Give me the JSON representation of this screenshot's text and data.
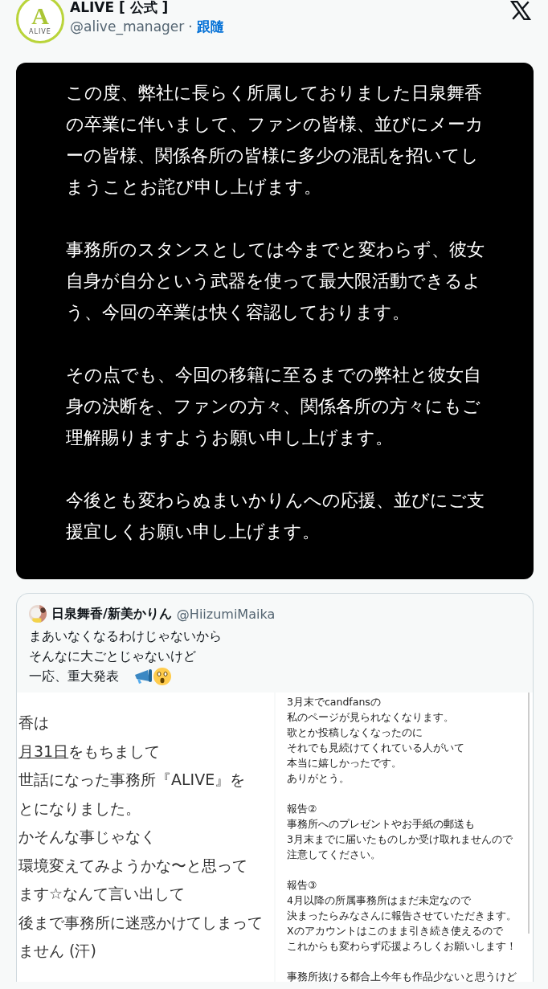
{
  "author": {
    "logo_letter": "A",
    "logo_word": "ALIVE",
    "name": "ALIVE [ 公式 ]",
    "handle": "@alive_manager",
    "separator": "·",
    "follow": "跟隨"
  },
  "statement": [
    [
      "この度、弊社に長らく所属しておりました日泉舞香",
      "の卒業に伴いまして、ファンの皆様、並びにメーカ",
      "ーの皆様、関係各所の皆様に多少の混乱を招いてし",
      "まうことお詫び申し上げます。"
    ],
    [
      "事務所のスタンスとしては今までと変わらず、彼女",
      "自身が自分という武器を使って最大限活動できるよ",
      "う、今回の卒業は快く容認しております。"
    ],
    [
      "その点でも、今回の移籍に至るまでの弊社と彼女自",
      "身の決断を、ファンの方々、関係各所の方々にもご",
      "理解賜りますようお願い申し上げます。"
    ],
    [
      "今後とも変わらぬまいかりんへの応援、並びにご支",
      "援宜しくお願い申し上げます。"
    ]
  ],
  "quote": {
    "name": "日泉舞香/新美かりん",
    "handle": "@HiizumiMaika",
    "lines": [
      "まあいなくなるわけじゃないから",
      "そんなに大ごとじゃないけど",
      "一応、重大発表"
    ],
    "left_image": [
      {
        "text": "香は"
      },
      {
        "underlined": "月31日",
        "text": "をもちまして"
      },
      {
        "text": "世話になった事務所『ALIVE』を"
      },
      {
        "text": "とになりました。"
      },
      {
        "text": "かそんな事じゃなく"
      },
      {
        "text": "環境変えてみようかな〜と思って"
      },
      {
        "text": "ます☆なんて言い出して"
      },
      {
        "text": "後まで事務所に迷惑かけてしまって"
      },
      {
        "text": "ません (汗)"
      }
    ],
    "right_image": [
      [
        "3月末でcandfansの",
        "私のページが見られなくなります。",
        "歌とか投稿しなくなったのに",
        "それでも見続けてくれている人がいて",
        "本当に嬉しかったです。",
        "ありがとう。"
      ],
      [
        "報告②",
        "事務所へのプレゼントやお手紙の郵送も",
        "3月末までに届いたものしか受け取れませんので",
        "注意してください。"
      ],
      [
        "報告③",
        "4月以降の所属事務所はまだ未定なので",
        "決まったらみなさんに報告させていただきます。",
        "Xのアカウントはこのまま引き続き使えるので",
        "これからも変わらず応援よろしくお願いします！"
      ],
      [
        "事務所抜ける都合上今年も作品少ないと思うけど"
      ]
    ]
  }
}
